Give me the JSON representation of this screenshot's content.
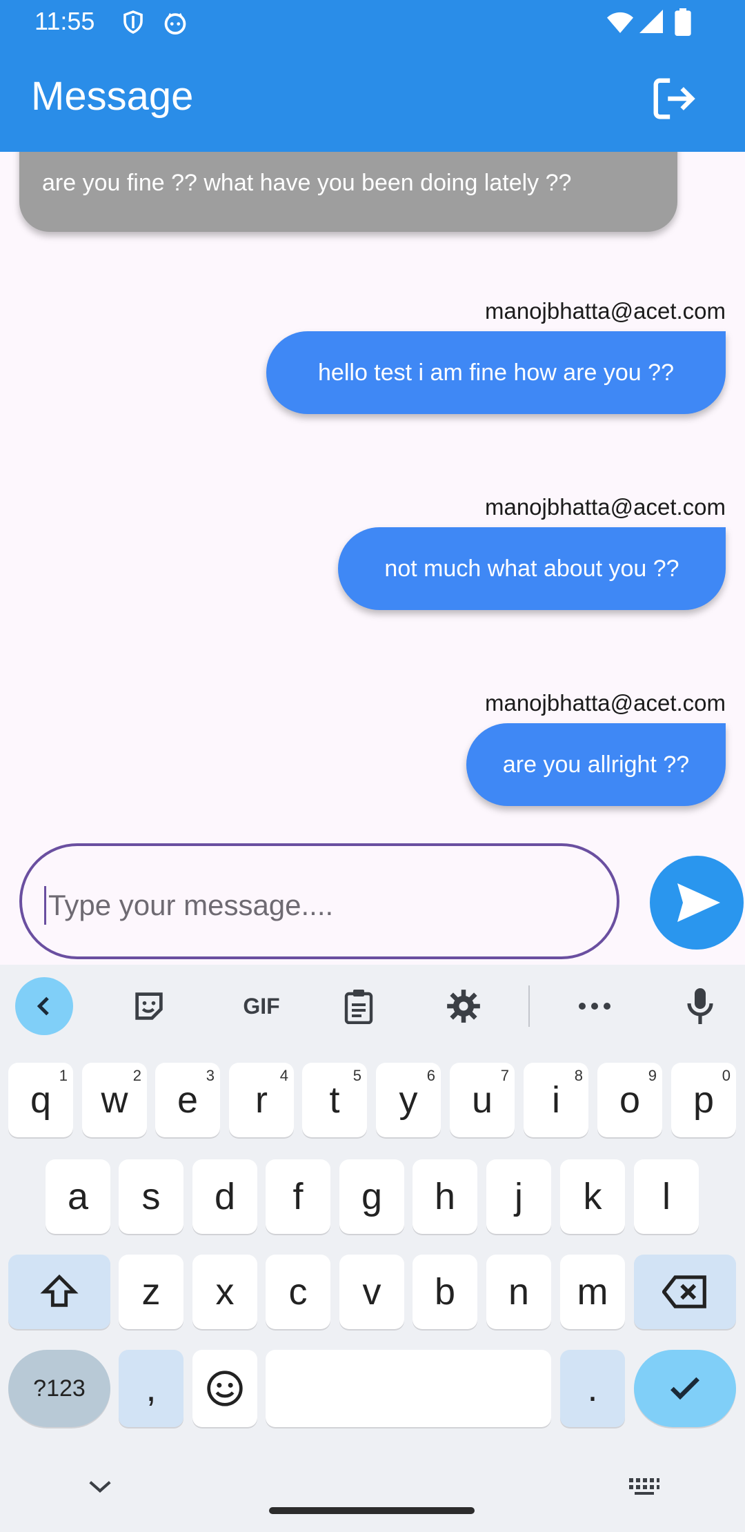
{
  "status": {
    "time": "11:55"
  },
  "appbar": {
    "title": "Message"
  },
  "chat": {
    "incoming": {
      "text": "are you fine ?? what have you been doing lately ??"
    },
    "messages": [
      {
        "sender": "manojbhatta@acet.com",
        "text": "hello test i am fine how are you ??"
      },
      {
        "sender": "manojbhatta@acet.com",
        "text": "not much what about you ??"
      },
      {
        "sender": "manojbhatta@acet.com",
        "text": "are you allright ??"
      }
    ]
  },
  "composer": {
    "placeholder": "Type your message...."
  },
  "keyboard": {
    "row1": [
      {
        "k": "q",
        "h": "1"
      },
      {
        "k": "w",
        "h": "2"
      },
      {
        "k": "e",
        "h": "3"
      },
      {
        "k": "r",
        "h": "4"
      },
      {
        "k": "t",
        "h": "5"
      },
      {
        "k": "y",
        "h": "6"
      },
      {
        "k": "u",
        "h": "7"
      },
      {
        "k": "i",
        "h": "8"
      },
      {
        "k": "o",
        "h": "9"
      },
      {
        "k": "p",
        "h": "0"
      }
    ],
    "row2": [
      "a",
      "s",
      "d",
      "f",
      "g",
      "h",
      "j",
      "k",
      "l"
    ],
    "row3": [
      "z",
      "x",
      "c",
      "v",
      "b",
      "n",
      "m"
    ],
    "toolbar": {
      "gif": "GIF"
    },
    "sym_label": "?123",
    "comma": ",",
    "period": "."
  }
}
